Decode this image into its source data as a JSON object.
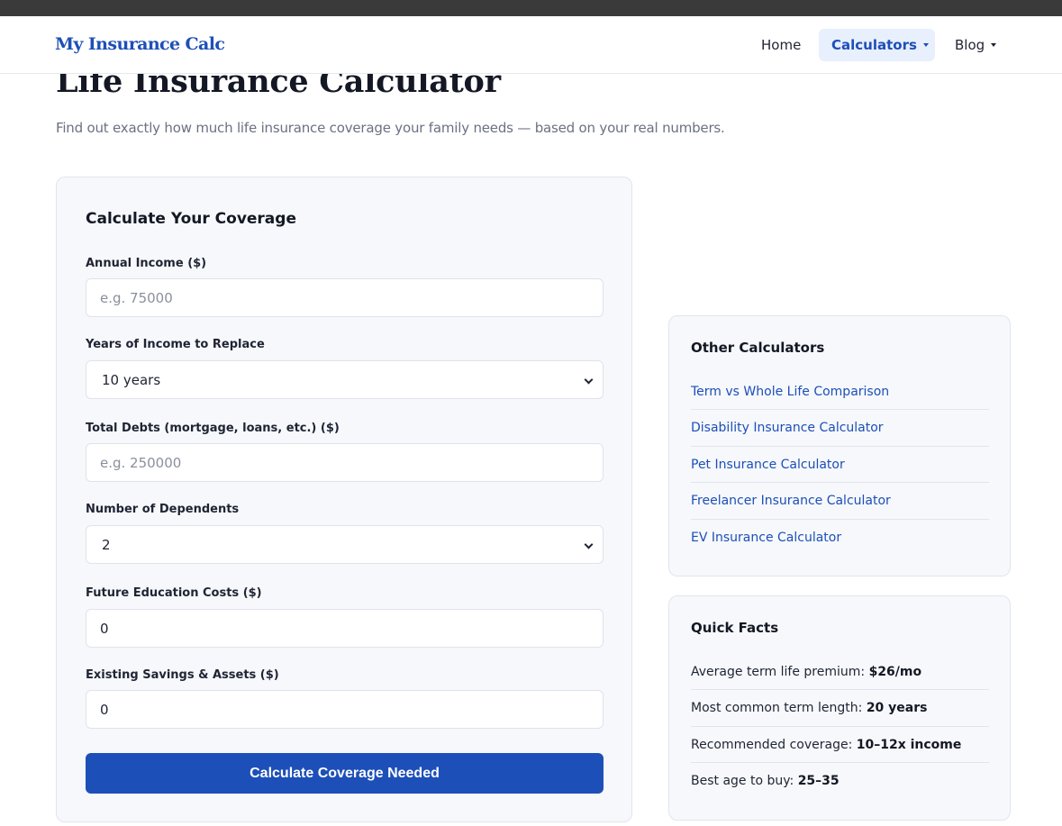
{
  "header": {
    "logo": "My Insurance Calc",
    "nav": {
      "home": "Home",
      "calculators": "Calculators",
      "blog": "Blog"
    }
  },
  "page": {
    "title": "Life Insurance Calculator",
    "subtitle": "Find out exactly how much life insurance coverage your family needs — based on your real numbers."
  },
  "form": {
    "title": "Calculate Your Coverage",
    "income": {
      "label": "Annual Income ($)",
      "placeholder": "e.g. 75000",
      "value": ""
    },
    "years": {
      "label": "Years of Income to Replace",
      "value": "10 years"
    },
    "debts": {
      "label": "Total Debts (mortgage, loans, etc.) ($)",
      "placeholder": "e.g. 250000",
      "value": ""
    },
    "dependents": {
      "label": "Number of Dependents",
      "value": "2"
    },
    "education": {
      "label": "Future Education Costs ($)",
      "value": "0"
    },
    "savings": {
      "label": "Existing Savings & Assets ($)",
      "value": "0"
    },
    "submit_label": "Calculate Coverage Needed"
  },
  "other_calculators": {
    "title": "Other Calculators",
    "items": [
      "Term vs Whole Life Comparison",
      "Disability Insurance Calculator",
      "Pet Insurance Calculator",
      "Freelancer Insurance Calculator",
      "EV Insurance Calculator"
    ]
  },
  "quick_facts": {
    "title": "Quick Facts",
    "items": [
      {
        "label": "Average term life premium:",
        "value": "$26/mo"
      },
      {
        "label": "Most common term length:",
        "value": "20 years"
      },
      {
        "label": "Recommended coverage:",
        "value": "10–12x income"
      },
      {
        "label": "Best age to buy:",
        "value": "25–35"
      }
    ]
  },
  "colors": {
    "brand": "#1d4fb8",
    "nav_active_bg": "#e8effd",
    "card_bg": "#f6f8fb",
    "top_strip": "#3a3a3b"
  }
}
